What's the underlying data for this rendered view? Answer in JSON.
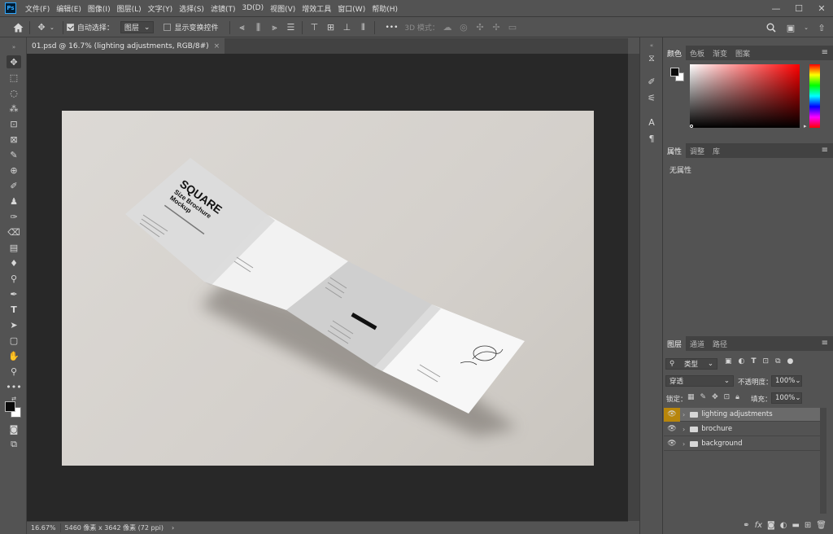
{
  "app": {
    "logo_text": "Ps"
  },
  "menubar": {
    "items": [
      "文件(F)",
      "编辑(E)",
      "图像(I)",
      "图层(L)",
      "文字(Y)",
      "选择(S)",
      "滤镜(T)",
      "3D(D)",
      "视图(V)",
      "增效工具",
      "窗口(W)",
      "帮助(H)"
    ],
    "minimize": "—",
    "maximize": "☐",
    "close": "✕"
  },
  "options": {
    "auto_select_label": "自动选择：",
    "auto_select_value": "图层",
    "show_transform_label": "显示变换控件",
    "more": "•••",
    "mode_3d_label": "3D 模式："
  },
  "document": {
    "tab_label": "01.psd @ 16.7% (lighting adjustments, RGB/8#)",
    "tab_close": "×"
  },
  "mockup": {
    "title": "SQUARE",
    "subtitle": "Size Brochure",
    "subtitle2": "Mockup"
  },
  "statusbar": {
    "zoom": "16.67%",
    "info": "5460 像素 x 3642 像素 (72 ppi)",
    "arrow": "›"
  },
  "color_panel": {
    "tabs": [
      "颜色",
      "色板",
      "渐变",
      "图案"
    ],
    "fg_color": "#0a0a0a",
    "bg_color": "#ffffff",
    "hue_color": "#ff0000"
  },
  "properties_panel": {
    "tabs": [
      "属性",
      "调整",
      "库"
    ],
    "body_text": "无属性"
  },
  "layers_panel": {
    "tabs": [
      "图层",
      "通道",
      "路径"
    ],
    "filter_label": "类型",
    "blend_mode": "穿透",
    "opacity_label": "不透明度：",
    "opacity_value": "100%",
    "lock_label": "锁定：",
    "fill_label": "填充：",
    "fill_value": "100%",
    "layers": [
      {
        "name": "lighting adjustments",
        "selected": true
      },
      {
        "name": "brochure",
        "selected": false
      },
      {
        "name": "background",
        "selected": false
      }
    ],
    "bottom_icons": [
      "link-icon",
      "fx-icon",
      "mask-icon",
      "adjustment-icon",
      "group-icon",
      "new-layer-icon",
      "trash-icon"
    ]
  }
}
